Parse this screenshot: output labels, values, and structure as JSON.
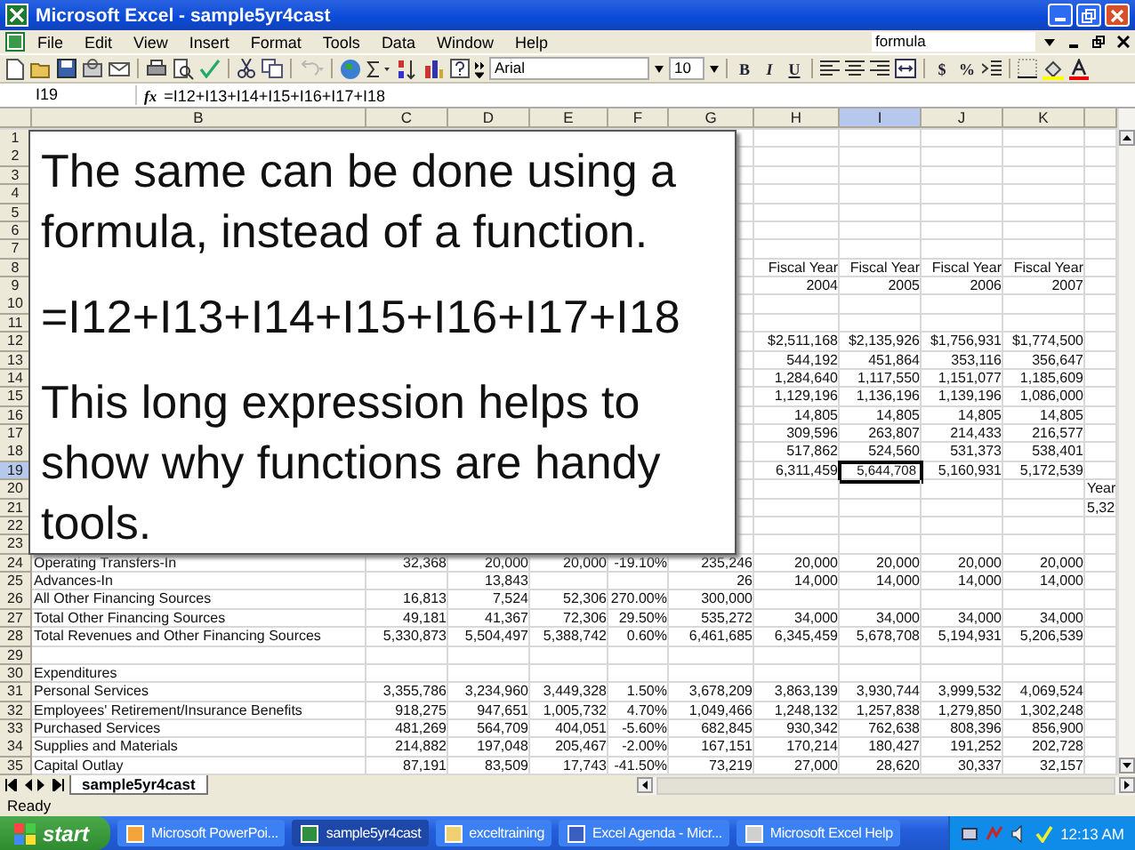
{
  "window": {
    "title": "Microsoft Excel - sample5yr4cast"
  },
  "menu": [
    {
      "label": "File"
    },
    {
      "label": "Edit"
    },
    {
      "label": "View"
    },
    {
      "label": "Insert"
    },
    {
      "label": "Format"
    },
    {
      "label": "Tools"
    },
    {
      "label": "Data"
    },
    {
      "label": "Window"
    },
    {
      "label": "Help"
    }
  ],
  "help_field": {
    "value": "formula"
  },
  "font": {
    "name": "Arial",
    "size": "10"
  },
  "format_buttons": [
    "B",
    "I",
    "U"
  ],
  "number_buttons": [
    "$",
    "%"
  ],
  "name_box": {
    "value": "I19"
  },
  "formula_bar": {
    "label": "fx",
    "value": "=I12+I13+I14+I15+I16+I17+I18"
  },
  "columns": [
    {
      "label": "B",
      "selected": false
    },
    {
      "label": "C",
      "selected": false
    },
    {
      "label": "D",
      "selected": false
    },
    {
      "label": "E",
      "selected": false
    },
    {
      "label": "F",
      "selected": false
    },
    {
      "label": "G",
      "selected": false
    },
    {
      "label": "H",
      "selected": false
    },
    {
      "label": "I",
      "selected": true
    },
    {
      "label": "J",
      "selected": false
    },
    {
      "label": "K",
      "selected": false
    }
  ],
  "rows": [
    {
      "number": "1",
      "selected": false,
      "cells": {}
    },
    {
      "number": "2",
      "selected": false,
      "cells": {}
    },
    {
      "number": "3",
      "selected": false,
      "cells": {}
    },
    {
      "number": "4",
      "selected": false,
      "cells": {}
    },
    {
      "number": "5",
      "selected": false,
      "cells": {}
    },
    {
      "number": "6",
      "selected": false,
      "cells": {}
    },
    {
      "number": "7",
      "selected": false,
      "cells": {}
    },
    {
      "number": "8",
      "selected": false,
      "cells": {
        "H": "Fiscal Year",
        "I": "Fiscal Year",
        "J": "Fiscal Year",
        "K": "Fiscal Year"
      }
    },
    {
      "number": "9",
      "selected": false,
      "cells": {
        "H": "2004",
        "I": "2005",
        "J": "2006",
        "K": "2007"
      }
    },
    {
      "number": "10",
      "selected": false,
      "cells": {}
    },
    {
      "number": "11",
      "selected": false,
      "cells": {}
    },
    {
      "number": "12",
      "selected": false,
      "cells": {
        "H": "$2,511,168",
        "I": "$2,135,926",
        "J": "$1,756,931",
        "K": "$1,774,500"
      }
    },
    {
      "number": "13",
      "selected": false,
      "cells": {
        "H": "544,192",
        "I": "451,864",
        "J": "353,116",
        "K": "356,647"
      }
    },
    {
      "number": "14",
      "selected": false,
      "cells": {
        "H": "1,284,640",
        "I": "1,117,550",
        "J": "1,151,077",
        "K": "1,185,609"
      }
    },
    {
      "number": "15",
      "selected": false,
      "cells": {
        "H": "1,129,196",
        "I": "1,136,196",
        "J": "1,139,196",
        "K": "1,086,000"
      }
    },
    {
      "number": "16",
      "selected": false,
      "cells": {
        "H": "14,805",
        "I": "14,805",
        "J": "14,805",
        "K": "14,805"
      }
    },
    {
      "number": "17",
      "selected": false,
      "cells": {
        "H": "309,596",
        "I": "263,807",
        "J": "214,433",
        "K": "216,577"
      }
    },
    {
      "number": "18",
      "selected": false,
      "cells": {
        "H": "517,862",
        "I": "524,560",
        "J": "531,373",
        "K": "538,401"
      }
    },
    {
      "number": "19",
      "selected": true,
      "cells": {
        "H": "6,311,459",
        "I": "5,644,708",
        "J": "5,160,931",
        "K": "5,172,539"
      }
    },
    {
      "number": "20",
      "selected": false,
      "cells": {
        "L": "Year"
      }
    },
    {
      "number": "21",
      "selected": false,
      "cells": {
        "L": "5,32"
      }
    },
    {
      "number": "22",
      "selected": false,
      "cells": {}
    },
    {
      "number": "23",
      "selected": false,
      "cells": {}
    },
    {
      "number": "24",
      "selected": false,
      "cells": {
        "B": "Operating Transfers-In",
        "C": "32,368",
        "D": "20,000",
        "E": "20,000",
        "F": "-19.10%",
        "G": "235,246",
        "H": "20,000",
        "I": "20,000",
        "J": "20,000",
        "K": "20,000"
      }
    },
    {
      "number": "25",
      "selected": false,
      "cells": {
        "B": "Advances-In",
        "D": "13,843",
        "G": "26",
        "H": "14,000",
        "I": "14,000",
        "J": "14,000",
        "K": "14,000"
      }
    },
    {
      "number": "26",
      "selected": false,
      "cells": {
        "B": "All Other Financing Sources",
        "C": "16,813",
        "D": "7,524",
        "E": "52,306",
        "F": "270.00%",
        "G": "300,000"
      }
    },
    {
      "number": "27",
      "selected": false,
      "cells": {
        "B": "Total Other Financing Sources",
        "C": "49,181",
        "D": "41,367",
        "E": "72,306",
        "F": "29.50%",
        "G": "535,272",
        "H": "34,000",
        "I": "34,000",
        "J": "34,000",
        "K": "34,000"
      }
    },
    {
      "number": "28",
      "selected": false,
      "cells": {
        "B": "Total Revenues and Other Financing Sources",
        "C": "5,330,873",
        "D": "5,504,497",
        "E": "5,388,742",
        "F": "0.60%",
        "G": "6,461,685",
        "H": "6,345,459",
        "I": "5,678,708",
        "J": "5,194,931",
        "K": "5,206,539"
      }
    },
    {
      "number": "29",
      "selected": false,
      "cells": {}
    },
    {
      "number": "30",
      "selected": false,
      "cells": {
        "B": "Expenditures"
      }
    },
    {
      "number": "31",
      "selected": false,
      "cells": {
        "B": "Personal Services",
        "C": "3,355,786",
        "D": "3,234,960",
        "E": "3,449,328",
        "F": "1.50%",
        "G": "3,678,209",
        "H": "3,863,139",
        "I": "3,930,744",
        "J": "3,999,532",
        "K": "4,069,524"
      }
    },
    {
      "number": "32",
      "selected": false,
      "cells": {
        "B": "Employees' Retirement/Insurance Benefits",
        "C": "918,275",
        "D": "947,651",
        "E": "1,005,732",
        "F": "4.70%",
        "G": "1,049,466",
        "H": "1,248,132",
        "I": "1,257,838",
        "J": "1,279,850",
        "K": "1,302,248"
      }
    },
    {
      "number": "33",
      "selected": false,
      "cells": {
        "B": "Purchased Services",
        "C": "481,269",
        "D": "564,709",
        "E": "404,051",
        "F": "-5.60%",
        "G": "682,845",
        "H": "930,342",
        "I": "762,638",
        "J": "808,396",
        "K": "856,900"
      }
    },
    {
      "number": "34",
      "selected": false,
      "cells": {
        "B": "Supplies and Materials",
        "C": "214,882",
        "D": "197,048",
        "E": "205,467",
        "F": "-2.00%",
        "G": "167,151",
        "H": "170,214",
        "I": "180,427",
        "J": "191,252",
        "K": "202,728"
      }
    },
    {
      "number": "35",
      "selected": false,
      "cells": {
        "B": "Capital Outlay",
        "C": "87,191",
        "D": "83,509",
        "E": "17,743",
        "F": "-41.50%",
        "G": "73,219",
        "H": "27,000",
        "I": "28,620",
        "J": "30,337",
        "K": "32,157"
      }
    }
  ],
  "callout": {
    "paragraphs": [
      "The same can be done using a formula, instead of a function.",
      "=I12+I13+I14+I15+I16+I17+I18",
      "This long expression helps to show why functions are handy tools."
    ]
  },
  "sheet_tabs": [
    {
      "label": "sample5yr4cast",
      "selected": true
    }
  ],
  "status_bar": {
    "text": "Ready"
  },
  "taskbar": {
    "start": "start",
    "tasks": [
      {
        "label": "Microsoft PowerPoi...",
        "selected": false
      },
      {
        "label": "sample5yr4cast",
        "selected": true
      },
      {
        "label": "exceltraining",
        "selected": false
      },
      {
        "label": "Excel Agenda - Micr...",
        "selected": false
      },
      {
        "label": "Microsoft Excel Help",
        "selected": false
      }
    ],
    "clock": "12:13 AM"
  }
}
